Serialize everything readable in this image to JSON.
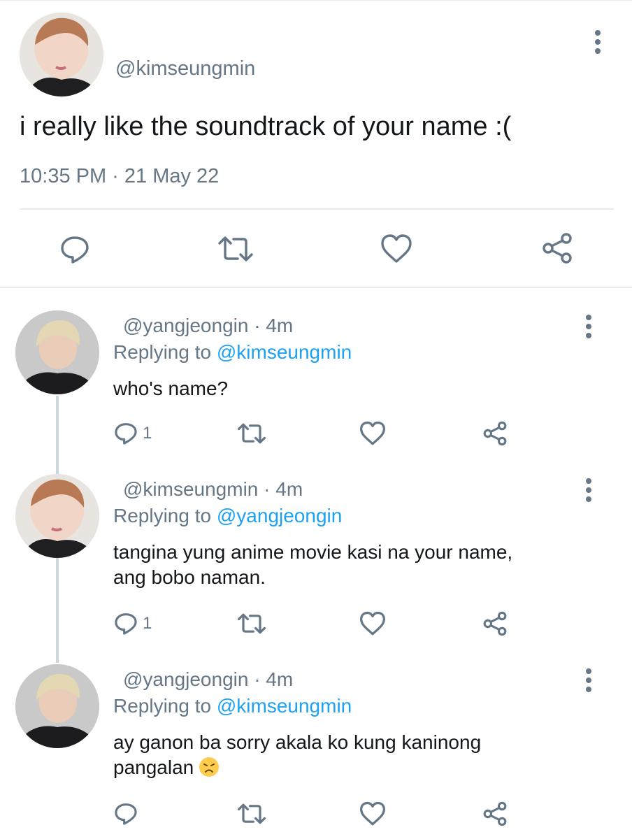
{
  "main_tweet": {
    "handle": "@kimseungmin",
    "text": "i really like the soundtrack of your name :(",
    "timestamp": "10:35 PM · 21 May 22"
  },
  "replies": [
    {
      "handle_time": "@yangjeongin · 4m",
      "replying_label": "Replying to",
      "replying_to": "@kimseungmin",
      "text_lines": [
        "who's name?"
      ],
      "reply_count": "1"
    },
    {
      "handle_time": "@kimseungmin · 4m",
      "replying_label": "Replying to",
      "replying_to": "@yangjeongin",
      "text_lines": [
        "tangina yung anime movie kasi na your name,",
        "ang bobo naman."
      ],
      "reply_count": "1"
    },
    {
      "handle_time": "@yangjeongin · 4m",
      "replying_label": "Replying to",
      "replying_to": "@kimseungmin",
      "text_lines": [
        "ay ganon ba sorry akala ko kung kaninong",
        "pangalan"
      ],
      "emoji": "disappointed-face-icon"
    }
  ],
  "colors": {
    "text": "#14171a",
    "secondary": "#657786",
    "link": "#1da1f2",
    "divider": "#e6ecf0",
    "thread_line": "#ccd6dd"
  },
  "icons": [
    "reply-icon",
    "retweet-icon",
    "like-icon",
    "share-icon",
    "more-icon"
  ]
}
